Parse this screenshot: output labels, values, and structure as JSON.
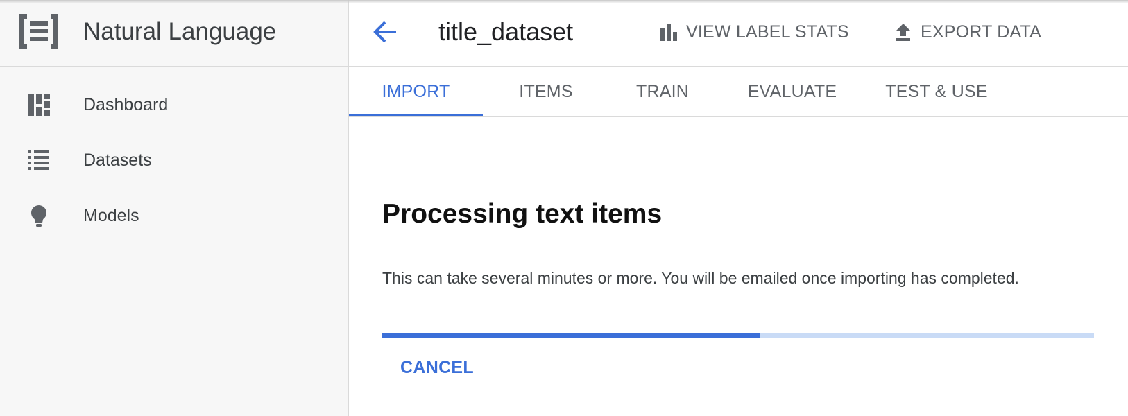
{
  "app": {
    "title": "Natural Language",
    "logo_icon": "natural-language-logo-icon"
  },
  "sidebar": {
    "items": [
      {
        "label": "Dashboard",
        "icon": "dashboard-icon"
      },
      {
        "label": "Datasets",
        "icon": "list-icon"
      },
      {
        "label": "Models",
        "icon": "lightbulb-icon"
      }
    ]
  },
  "header": {
    "back_icon": "arrow-back-icon",
    "dataset_title": "title_dataset",
    "actions": [
      {
        "label": "VIEW LABEL STATS",
        "icon": "bar-chart-icon"
      },
      {
        "label": "EXPORT DATA",
        "icon": "upload-icon"
      }
    ]
  },
  "tabs": [
    {
      "label": "IMPORT",
      "active": true
    },
    {
      "label": "ITEMS",
      "active": false
    },
    {
      "label": "TRAIN",
      "active": false
    },
    {
      "label": "EVALUATE",
      "active": false
    },
    {
      "label": "TEST & USE",
      "active": false
    }
  ],
  "main": {
    "title": "Processing text items",
    "description": "This can take several minutes or more. You will be emailed once importing has completed.",
    "progress_fraction": 0.53,
    "cancel_label": "CANCEL"
  },
  "colors": {
    "accent": "#3b6fd8",
    "progress_track": "#c9dbf6",
    "sidebar_bg": "#f7f7f7"
  }
}
